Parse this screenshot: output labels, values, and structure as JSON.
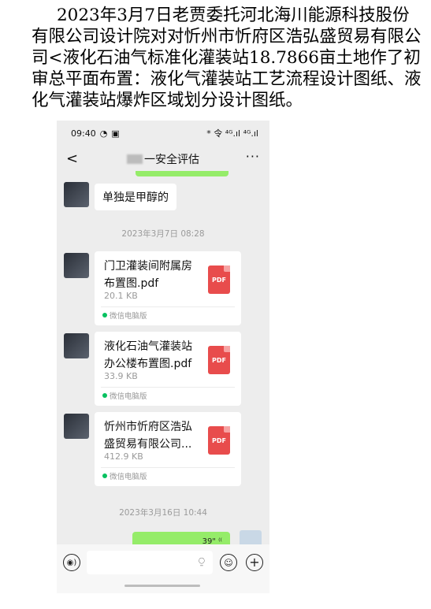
{
  "article": {
    "text": "2023年3月7日老贾委托河北海川能源科技股份有限公司设计院对对忻州市忻府区浩弘盛贸易有限公司<液化石油气标准化灌装站18.7866亩土地作了初审总平面布置：液化气灌装站工艺流程设计图纸、液化气灌装站爆炸区域划分设计图纸。"
  },
  "status_bar": {
    "time": "09:40",
    "left_icons": [
      "signal-icon",
      "message-icon"
    ],
    "right_text": "* 令 ⁴ᴳ.ıl ⁴ᴳ.ıl"
  },
  "chat": {
    "title": "一安全评估",
    "back_symbol": "<",
    "more_symbol": "···"
  },
  "messages": [
    {
      "type": "text",
      "text": "单独是甲醇的"
    }
  ],
  "timestamps": {
    "first": "2023年3月7日 08:28",
    "second": "2023年3月16日 10:44"
  },
  "files": [
    {
      "name": "门卫灌装间附属房布置图.pdf",
      "size": "20.1 KB",
      "source": "微信电脑版",
      "badge": "PDF"
    },
    {
      "name": "液化石油气灌装站办公楼布置图.pdf",
      "size": "33.9 KB",
      "source": "微信电脑版",
      "badge": "PDF"
    },
    {
      "name": "忻州市忻府区浩弘盛贸易有限公司...",
      "size": "412.9 KB",
      "source": "微信电脑版",
      "badge": "PDF"
    }
  ],
  "last_message_partial": "39\" ⁽⁽",
  "colors": {
    "green": "#95ec69",
    "pdf_red": "#e84c4c",
    "chat_bg": "#ededed"
  }
}
